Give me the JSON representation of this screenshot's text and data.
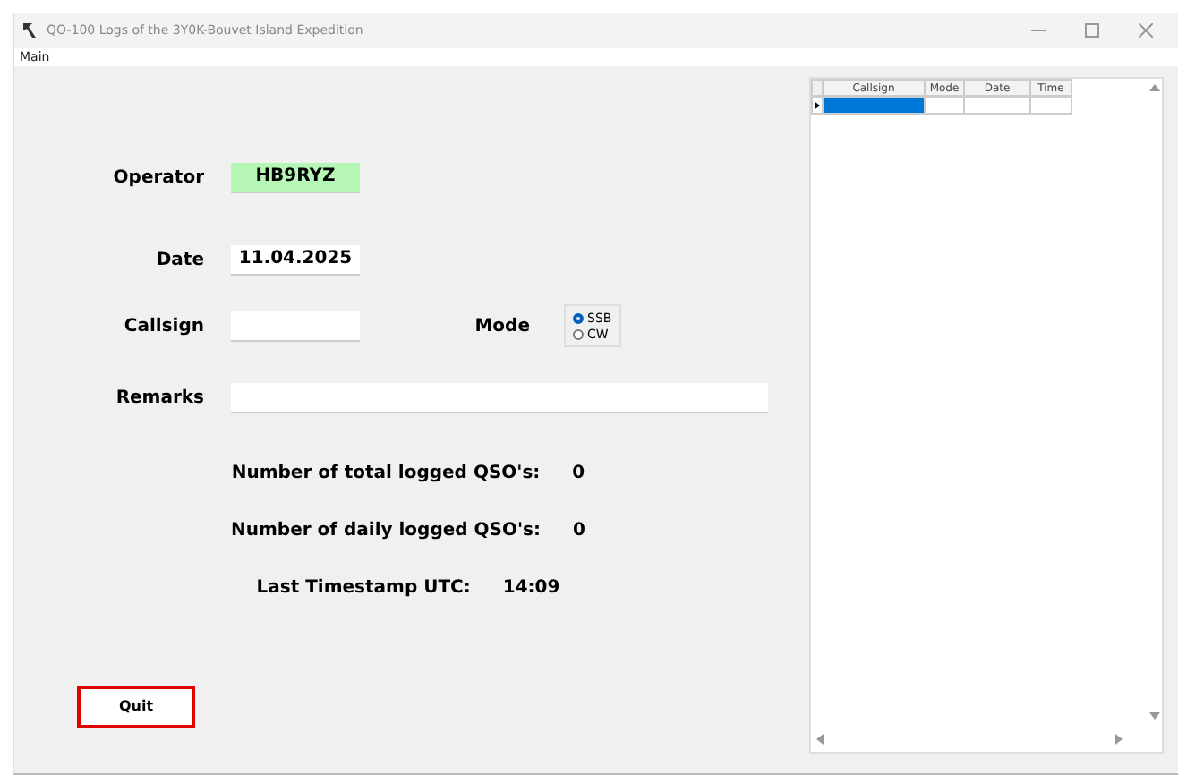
{
  "window": {
    "title": "QO-100 Logs of the 3Y0K-Bouvet Island Expedition"
  },
  "menu": [
    "Main"
  ],
  "form": {
    "operator": {
      "label": "Operator",
      "value": "HB9RYZ"
    },
    "date": {
      "label": "Date",
      "value": "11.04.2025"
    },
    "callsign": {
      "label": "Callsign"
    },
    "mode": {
      "label": "Mode",
      "options": [
        {
          "label": "SSB",
          "selected": true
        },
        {
          "label": "CW",
          "selected": false
        }
      ]
    },
    "remarks": {
      "label": "Remarks"
    }
  },
  "stats": [
    {
      "label": "Number of total logged QSO's:",
      "value": "0"
    },
    {
      "label": "Number of daily logged QSO's:",
      "value": "0"
    },
    {
      "label": "Last Timestamp UTC:",
      "value": "14:09"
    }
  ],
  "buttons": [
    "Quit"
  ],
  "table": {
    "columns": [
      "Callsign",
      "Mode",
      "Date",
      "Time"
    ]
  }
}
